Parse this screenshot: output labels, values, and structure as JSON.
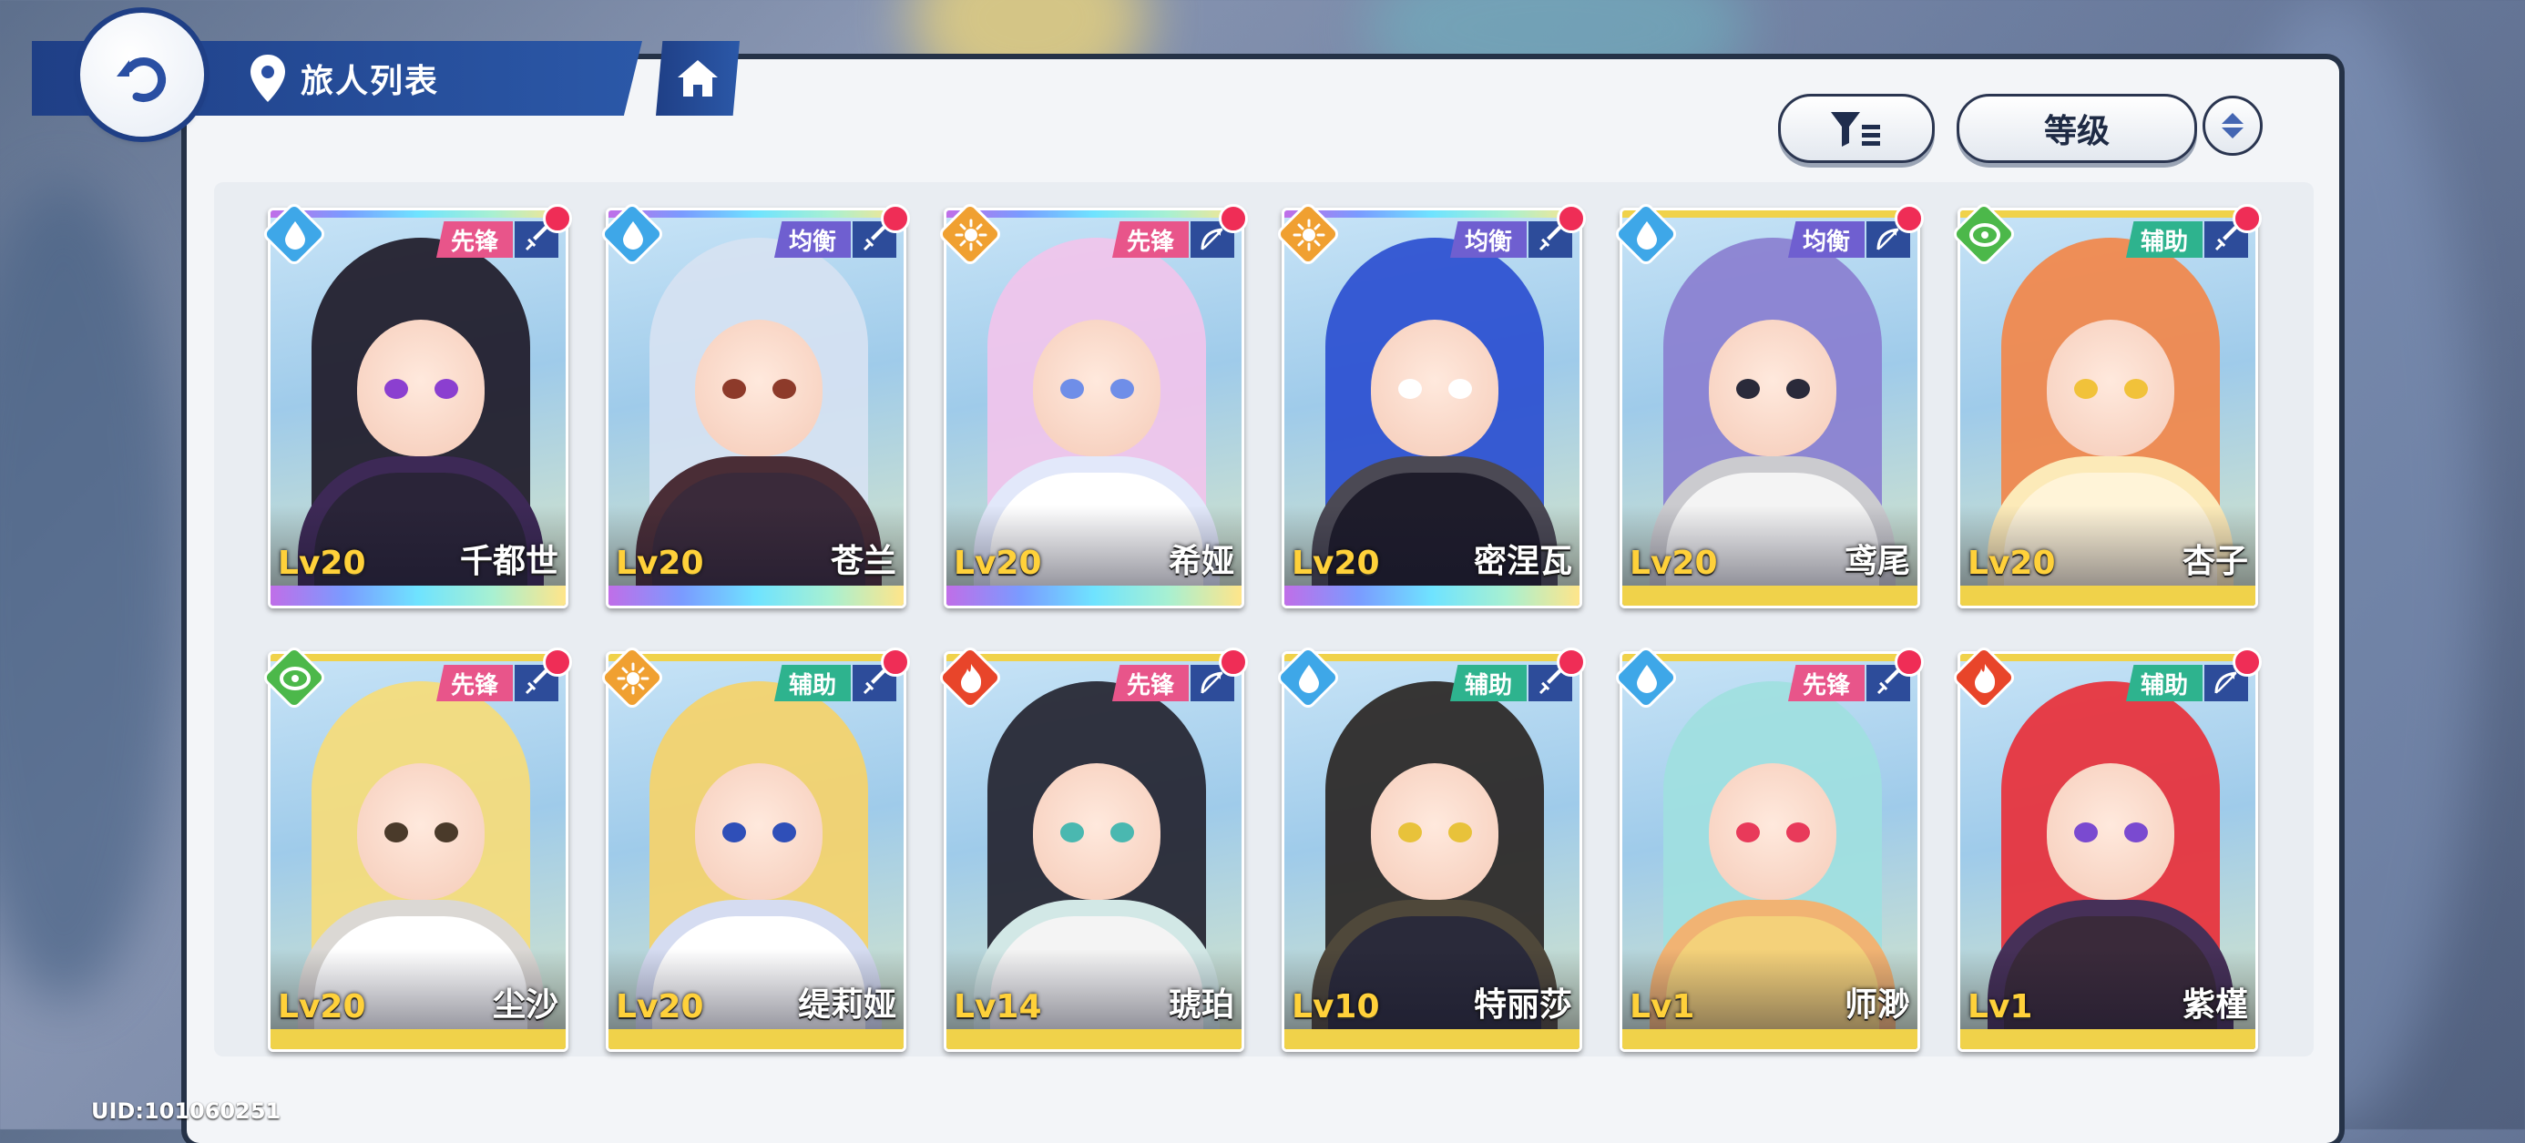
{
  "header": {
    "title": "旅人列表"
  },
  "toolbar": {
    "sort_label": "等级"
  },
  "footer": {
    "uid": "UID:101060251"
  },
  "colors": {
    "rainbow_bar": "linear-gradient(90deg,#c06ee8,#7a9bff,#6fe3ff,#a7f0d2,#ffe58a)",
    "gold_bar": "#f0d24a",
    "water": "#3ea7e8",
    "light": "#f0a031",
    "grass": "#4cb84a",
    "fire": "#e8452a"
  },
  "roles": {
    "vanguard": "先锋",
    "balanced": "均衡",
    "support": "辅助"
  },
  "travelers": [
    {
      "name": "千都世",
      "level": "Lv20",
      "role": "先锋",
      "role_color": "#e8558a",
      "element": "water",
      "weapon": "sword",
      "rarity": "rainbow",
      "hair": "#1e1a28",
      "outfit": "#2a2438",
      "accent": "#8b3fd0"
    },
    {
      "name": "苍兰",
      "level": "Lv20",
      "role": "均衡",
      "role_color": "#6f5fd0",
      "element": "water",
      "weapon": "sword",
      "rarity": "rainbow",
      "hair": "#d6e2f2",
      "outfit": "#3a2a3a",
      "accent": "#8d3a2a"
    },
    {
      "name": "希娅",
      "level": "Lv20",
      "role": "先锋",
      "role_color": "#e8558a",
      "element": "light",
      "weapon": "bow",
      "rarity": "rainbow",
      "hair": "#f1c4ec",
      "outfit": "#ffffff",
      "accent": "#6f8ee8"
    },
    {
      "name": "密涅瓦",
      "level": "Lv20",
      "role": "均衡",
      "role_color": "#6f5fd0",
      "element": "light",
      "weapon": "sword",
      "rarity": "rainbow",
      "hair": "#2b4fd0",
      "outfit": "#1e1c2a",
      "accent": "#ffffff"
    },
    {
      "name": "鸢尾",
      "level": "Lv20",
      "role": "均衡",
      "role_color": "#6f5fd0",
      "element": "water",
      "weapon": "bow",
      "rarity": "gold",
      "hair": "#8a7fd0",
      "outfit": "#f4f4f4",
      "accent": "#2a2a3a"
    },
    {
      "name": "杏子",
      "level": "Lv20",
      "role": "辅助",
      "role_color": "#2eb38e",
      "element": "grass",
      "weapon": "sword",
      "rarity": "gold",
      "hair": "#f2874a",
      "outfit": "#fff4d8",
      "accent": "#f1c23a"
    },
    {
      "name": "尘沙",
      "level": "Lv20",
      "role": "先锋",
      "role_color": "#e8558a",
      "element": "grass",
      "weapon": "sword",
      "rarity": "gold",
      "hair": "#f6dc7a",
      "outfit": "#ffffff",
      "accent": "#4a3a2a"
    },
    {
      "name": "缇莉娅",
      "level": "Lv20",
      "role": "辅助",
      "role_color": "#2eb38e",
      "element": "light",
      "weapon": "sword",
      "rarity": "gold",
      "hair": "#f5d36a",
      "outfit": "#ffffff",
      "accent": "#2f4fb8"
    },
    {
      "name": "琥珀",
      "level": "Lv14",
      "role": "先锋",
      "role_color": "#e8558a",
      "element": "fire",
      "weapon": "bow",
      "rarity": "gold",
      "hair": "#242430",
      "outfit": "#f4f4f4",
      "accent": "#4ab8b0"
    },
    {
      "name": "特丽莎",
      "level": "Lv10",
      "role": "辅助",
      "role_color": "#2eb38e",
      "element": "water",
      "weapon": "sword",
      "rarity": "gold",
      "hair": "#2a2624",
      "outfit": "#2a2a3a",
      "accent": "#e8c23a"
    },
    {
      "name": "师渺",
      "level": "Lv1",
      "role": "先锋",
      "role_color": "#e8558a",
      "element": "water",
      "weapon": "sword",
      "rarity": "gold",
      "hair": "#9fe0df",
      "outfit": "#f4d17a",
      "accent": "#e83a5a"
    },
    {
      "name": "紫槿",
      "level": "Lv1",
      "role": "辅助",
      "role_color": "#2eb38e",
      "element": "fire",
      "weapon": "bow",
      "rarity": "gold",
      "hair": "#e8303a",
      "outfit": "#3a2a3a",
      "accent": "#7a4ad0"
    }
  ]
}
